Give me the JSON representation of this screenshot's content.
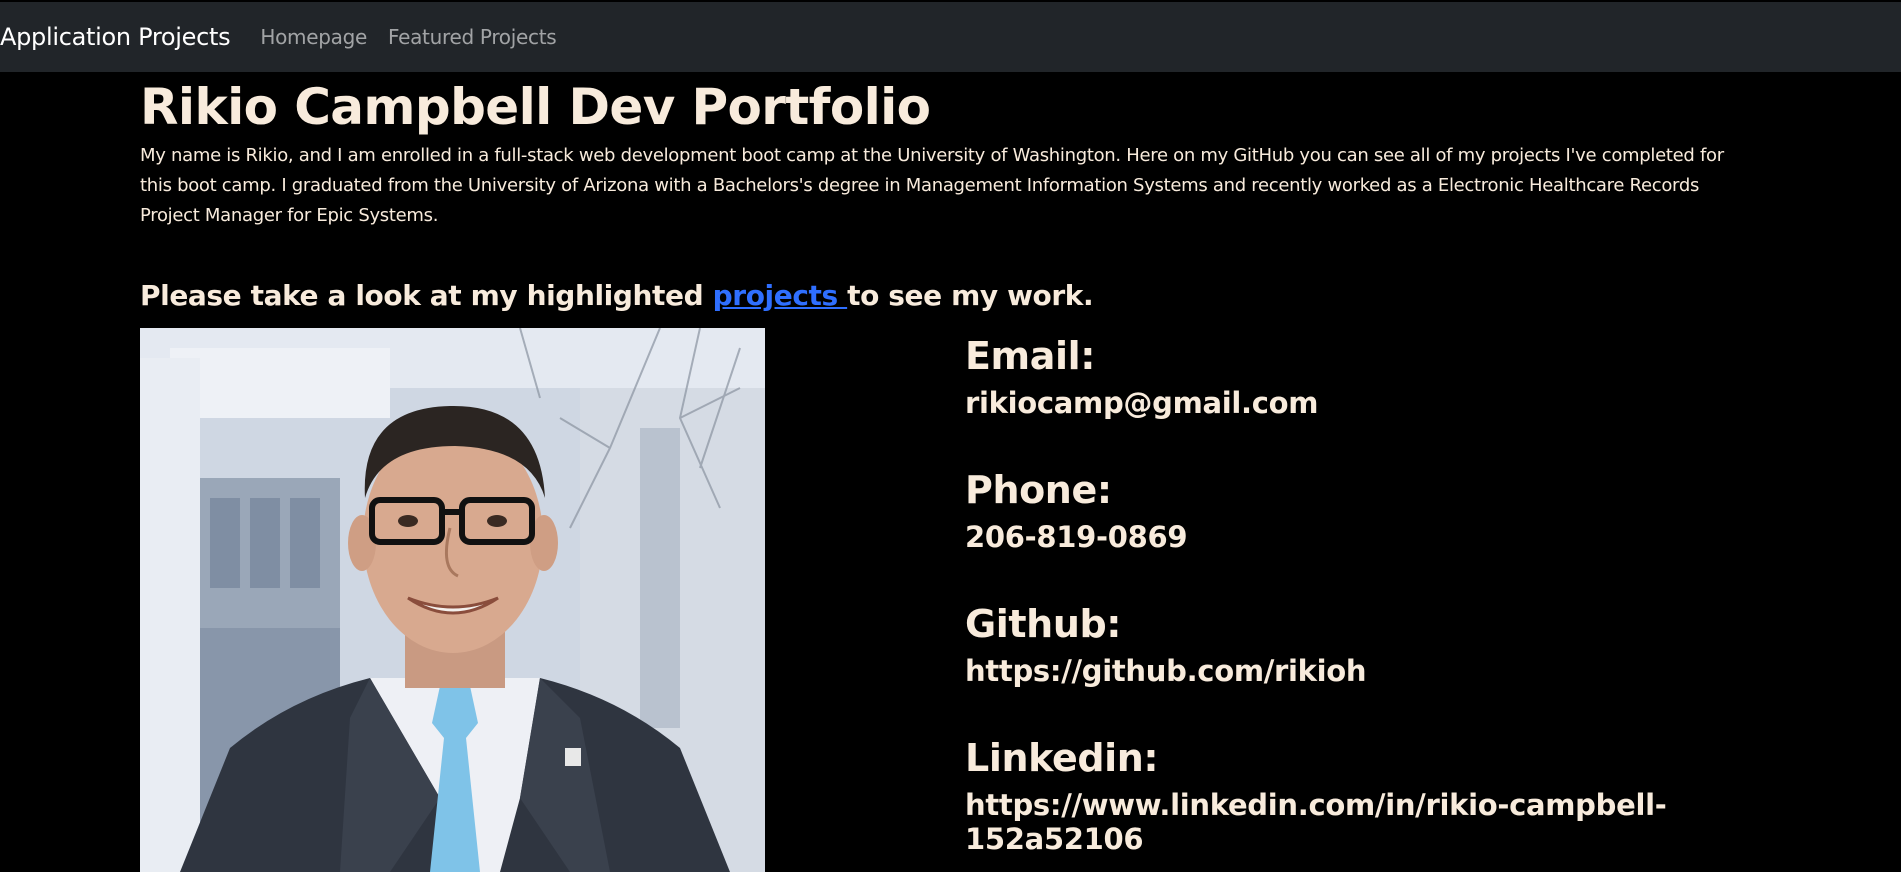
{
  "nav": {
    "brand": "Application Projects",
    "links": [
      "Homepage",
      "Featured Projects"
    ]
  },
  "hero": {
    "title": "Rikio Campbell Dev Portfolio",
    "bio": "My name is Rikio, and I am enrolled in a full-stack web development boot camp at the University of Washington. Here on my GitHub you can see all of my projects I've completed for this boot camp. I graduated from the University of Arizona with a Bachelors's degree in Management Information Systems and recently worked as a Electronic Healthcare Records Project Manager for Epic Systems.",
    "cta_before": "Please take a look at my highlighted ",
    "cta_link": "projects ",
    "cta_after": "to see my work."
  },
  "contact": [
    {
      "label": "Email:",
      "value": "rikiocamp@gmail.com"
    },
    {
      "label": "Phone:",
      "value": "206-819-0869"
    },
    {
      "label": "Github:",
      "value": "https://github.com/rikioh"
    },
    {
      "label": "Linkedin:",
      "value": "https://www.linkedin.com/in/rikio-campbell-152a52106"
    }
  ],
  "colors": {
    "navbar_bg": "#212529",
    "page_bg": "#000000",
    "text": "#f8ebdc",
    "link": "#2f6fff"
  }
}
